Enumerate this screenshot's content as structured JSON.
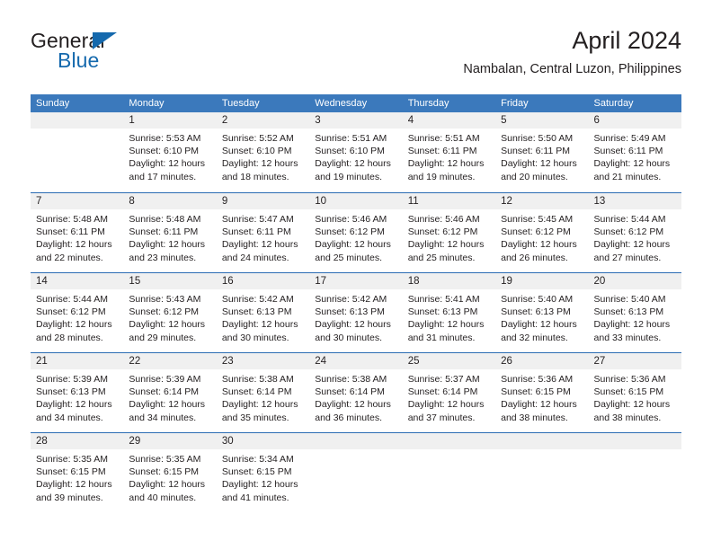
{
  "brand": {
    "name_part1": "General",
    "name_part2": "Blue",
    "accent_color": "#1569ad",
    "logo_icon": "triangle-flag-icon"
  },
  "header": {
    "month_title": "April 2024",
    "location": "Nambalan, Central Luzon, Philippines"
  },
  "colors": {
    "header_row_bg": "#3b79bc",
    "row_divider": "#2b6cb3",
    "day_band_bg": "#f0f0f0",
    "text": "#231f20"
  },
  "weekday_headers": [
    "Sunday",
    "Monday",
    "Tuesday",
    "Wednesday",
    "Thursday",
    "Friday",
    "Saturday"
  ],
  "weeks": [
    [
      {
        "day": "",
        "lines": [],
        "empty": true
      },
      {
        "day": "1",
        "lines": [
          "Sunrise: 5:53 AM",
          "Sunset: 6:10 PM",
          "Daylight: 12 hours",
          "and 17 minutes."
        ],
        "empty": false
      },
      {
        "day": "2",
        "lines": [
          "Sunrise: 5:52 AM",
          "Sunset: 6:10 PM",
          "Daylight: 12 hours",
          "and 18 minutes."
        ],
        "empty": false
      },
      {
        "day": "3",
        "lines": [
          "Sunrise: 5:51 AM",
          "Sunset: 6:10 PM",
          "Daylight: 12 hours",
          "and 19 minutes."
        ],
        "empty": false
      },
      {
        "day": "4",
        "lines": [
          "Sunrise: 5:51 AM",
          "Sunset: 6:11 PM",
          "Daylight: 12 hours",
          "and 19 minutes."
        ],
        "empty": false
      },
      {
        "day": "5",
        "lines": [
          "Sunrise: 5:50 AM",
          "Sunset: 6:11 PM",
          "Daylight: 12 hours",
          "and 20 minutes."
        ],
        "empty": false
      },
      {
        "day": "6",
        "lines": [
          "Sunrise: 5:49 AM",
          "Sunset: 6:11 PM",
          "Daylight: 12 hours",
          "and 21 minutes."
        ],
        "empty": false
      }
    ],
    [
      {
        "day": "7",
        "lines": [
          "Sunrise: 5:48 AM",
          "Sunset: 6:11 PM",
          "Daylight: 12 hours",
          "and 22 minutes."
        ],
        "empty": false
      },
      {
        "day": "8",
        "lines": [
          "Sunrise: 5:48 AM",
          "Sunset: 6:11 PM",
          "Daylight: 12 hours",
          "and 23 minutes."
        ],
        "empty": false
      },
      {
        "day": "9",
        "lines": [
          "Sunrise: 5:47 AM",
          "Sunset: 6:11 PM",
          "Daylight: 12 hours",
          "and 24 minutes."
        ],
        "empty": false
      },
      {
        "day": "10",
        "lines": [
          "Sunrise: 5:46 AM",
          "Sunset: 6:12 PM",
          "Daylight: 12 hours",
          "and 25 minutes."
        ],
        "empty": false
      },
      {
        "day": "11",
        "lines": [
          "Sunrise: 5:46 AM",
          "Sunset: 6:12 PM",
          "Daylight: 12 hours",
          "and 25 minutes."
        ],
        "empty": false
      },
      {
        "day": "12",
        "lines": [
          "Sunrise: 5:45 AM",
          "Sunset: 6:12 PM",
          "Daylight: 12 hours",
          "and 26 minutes."
        ],
        "empty": false
      },
      {
        "day": "13",
        "lines": [
          "Sunrise: 5:44 AM",
          "Sunset: 6:12 PM",
          "Daylight: 12 hours",
          "and 27 minutes."
        ],
        "empty": false
      }
    ],
    [
      {
        "day": "14",
        "lines": [
          "Sunrise: 5:44 AM",
          "Sunset: 6:12 PM",
          "Daylight: 12 hours",
          "and 28 minutes."
        ],
        "empty": false
      },
      {
        "day": "15",
        "lines": [
          "Sunrise: 5:43 AM",
          "Sunset: 6:12 PM",
          "Daylight: 12 hours",
          "and 29 minutes."
        ],
        "empty": false
      },
      {
        "day": "16",
        "lines": [
          "Sunrise: 5:42 AM",
          "Sunset: 6:13 PM",
          "Daylight: 12 hours",
          "and 30 minutes."
        ],
        "empty": false
      },
      {
        "day": "17",
        "lines": [
          "Sunrise: 5:42 AM",
          "Sunset: 6:13 PM",
          "Daylight: 12 hours",
          "and 30 minutes."
        ],
        "empty": false
      },
      {
        "day": "18",
        "lines": [
          "Sunrise: 5:41 AM",
          "Sunset: 6:13 PM",
          "Daylight: 12 hours",
          "and 31 minutes."
        ],
        "empty": false
      },
      {
        "day": "19",
        "lines": [
          "Sunrise: 5:40 AM",
          "Sunset: 6:13 PM",
          "Daylight: 12 hours",
          "and 32 minutes."
        ],
        "empty": false
      },
      {
        "day": "20",
        "lines": [
          "Sunrise: 5:40 AM",
          "Sunset: 6:13 PM",
          "Daylight: 12 hours",
          "and 33 minutes."
        ],
        "empty": false
      }
    ],
    [
      {
        "day": "21",
        "lines": [
          "Sunrise: 5:39 AM",
          "Sunset: 6:13 PM",
          "Daylight: 12 hours",
          "and 34 minutes."
        ],
        "empty": false
      },
      {
        "day": "22",
        "lines": [
          "Sunrise: 5:39 AM",
          "Sunset: 6:14 PM",
          "Daylight: 12 hours",
          "and 34 minutes."
        ],
        "empty": false
      },
      {
        "day": "23",
        "lines": [
          "Sunrise: 5:38 AM",
          "Sunset: 6:14 PM",
          "Daylight: 12 hours",
          "and 35 minutes."
        ],
        "empty": false
      },
      {
        "day": "24",
        "lines": [
          "Sunrise: 5:38 AM",
          "Sunset: 6:14 PM",
          "Daylight: 12 hours",
          "and 36 minutes."
        ],
        "empty": false
      },
      {
        "day": "25",
        "lines": [
          "Sunrise: 5:37 AM",
          "Sunset: 6:14 PM",
          "Daylight: 12 hours",
          "and 37 minutes."
        ],
        "empty": false
      },
      {
        "day": "26",
        "lines": [
          "Sunrise: 5:36 AM",
          "Sunset: 6:15 PM",
          "Daylight: 12 hours",
          "and 38 minutes."
        ],
        "empty": false
      },
      {
        "day": "27",
        "lines": [
          "Sunrise: 5:36 AM",
          "Sunset: 6:15 PM",
          "Daylight: 12 hours",
          "and 38 minutes."
        ],
        "empty": false
      }
    ],
    [
      {
        "day": "28",
        "lines": [
          "Sunrise: 5:35 AM",
          "Sunset: 6:15 PM",
          "Daylight: 12 hours",
          "and 39 minutes."
        ],
        "empty": false
      },
      {
        "day": "29",
        "lines": [
          "Sunrise: 5:35 AM",
          "Sunset: 6:15 PM",
          "Daylight: 12 hours",
          "and 40 minutes."
        ],
        "empty": false
      },
      {
        "day": "30",
        "lines": [
          "Sunrise: 5:34 AM",
          "Sunset: 6:15 PM",
          "Daylight: 12 hours",
          "and 41 minutes."
        ],
        "empty": false
      },
      {
        "day": "",
        "lines": [],
        "empty": true
      },
      {
        "day": "",
        "lines": [],
        "empty": true
      },
      {
        "day": "",
        "lines": [],
        "empty": true
      },
      {
        "day": "",
        "lines": [],
        "empty": true
      }
    ]
  ]
}
